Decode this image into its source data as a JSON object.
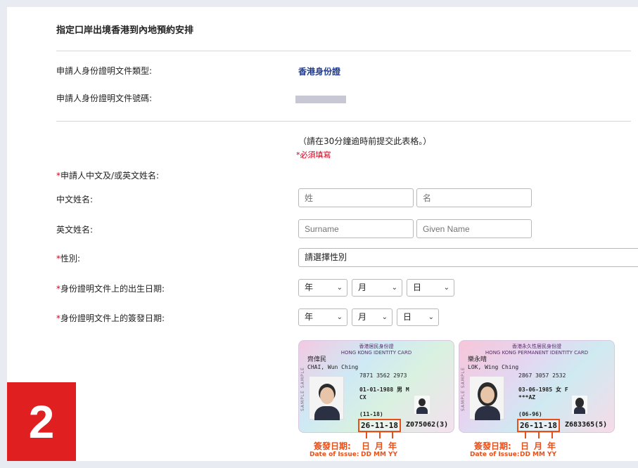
{
  "page": {
    "title": "指定口岸出境香港到內地預約安排",
    "instruction": "（請在30分鐘逾時前提交此表格。）",
    "required_note": "*必須填寫"
  },
  "info": {
    "doc_type_label": "申請人身份證明文件類型:",
    "doc_type_value": "香港身份證",
    "doc_no_label": "申請人身份證明文件號碼:"
  },
  "form": {
    "name_section_label": "申請人中文及/或英文姓名:",
    "chinese_name_label": "中文姓名:",
    "surname_cn_placeholder": "姓",
    "given_cn_placeholder": "名",
    "english_name_label": "英文姓名:",
    "surname_en_placeholder": "Surname",
    "given_en_placeholder": "Given Name",
    "gender_label": "性別:",
    "gender_value": "請選擇性別",
    "dob_label": "身份證明文件上的出生日期:",
    "issue_label": "身份證明文件上的簽發日期:",
    "year_value": "年",
    "month_value": "月",
    "day_value": "日",
    "required_mark": "*"
  },
  "cards": {
    "card1": {
      "header_cn": "香港居民身份證",
      "header_en": "HONG KONG IDENTITY CARD",
      "name_cn": "齊偉民",
      "name_en": "CHAI, Wun Ching",
      "ccc": "7871 3562 2973",
      "dob": "01-01-1988",
      "gender": "男 M",
      "code": "CX",
      "issue_code": "(11-18)",
      "issue_date": "26-11-18",
      "serial": "Z075062(3)",
      "sample": "SAMPLE SAMPLE"
    },
    "card2": {
      "header_cn": "香港永久性居民身份證",
      "header_en": "HONG KONG PERMANENT IDENTITY CARD",
      "name_cn": "樂永晴",
      "name_en": "LOK, Wing Ching",
      "ccc": "2867 3057 2532",
      "dob": "03-06-1985",
      "gender": "女 F",
      "code": "***AZ",
      "issue_code": "(06-96)",
      "issue_date": "26-11-18",
      "serial": "Z683365(5)",
      "sample": "SAMPLE SAMPLE"
    }
  },
  "annotations": {
    "issue_label_cn": "簽發日期:",
    "issue_label_en": "Date of Issue:",
    "day_cn": "日",
    "month_cn": "月",
    "year_cn": "年",
    "day_en": "DD",
    "month_en": "MM",
    "year_en": "YY"
  },
  "badge": {
    "step": "2"
  },
  "colors": {
    "required": "#d0021b",
    "accent": "#e8501a",
    "badge": "#e02020",
    "link_blue": "#1f3a8a"
  }
}
